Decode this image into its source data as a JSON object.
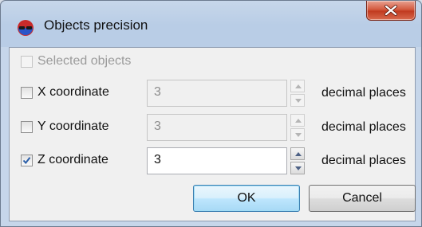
{
  "window": {
    "title": "Objects precision",
    "app_icon": "red-blue-glasses-icon",
    "close_icon": "close-x-icon"
  },
  "selected_objects": {
    "label": "Selected objects",
    "checked": false,
    "enabled": false
  },
  "rows": [
    {
      "label": "X coordinate",
      "checked": false,
      "value": "3",
      "unit": "decimal places",
      "enabled": false
    },
    {
      "label": "Y coordinate",
      "checked": false,
      "value": "3",
      "unit": "decimal places",
      "enabled": false
    },
    {
      "label": "Z coordinate",
      "checked": true,
      "value": "3",
      "unit": "decimal places",
      "enabled": true
    }
  ],
  "buttons": {
    "ok": "OK",
    "cancel": "Cancel"
  },
  "colors": {
    "title_bar": "#b9cde6",
    "close_button": "#c13b20",
    "dialog_bg": "#f0f0f0",
    "check": "#2a5ea8"
  }
}
